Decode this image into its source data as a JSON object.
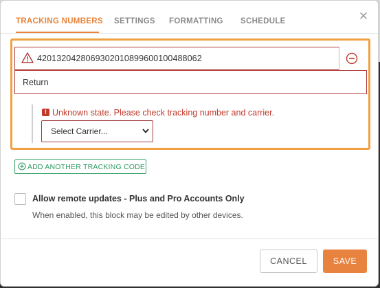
{
  "tabs": [
    {
      "label": "TRACKING NUMBERS",
      "active": true
    },
    {
      "label": "SETTINGS",
      "active": false
    },
    {
      "label": "FORMATTING",
      "active": false
    },
    {
      "label": "SCHEDULE",
      "active": false
    }
  ],
  "close_icon": "close-icon",
  "tracking": {
    "number": "420132042806930201089960010048806 2",
    "number_display": "4201320428069302010899600100488062",
    "description": "Return",
    "error_message": "Unknown state. Please check tracking number and carrier.",
    "carrier_selected": "Select Carrier...",
    "warning_icon": "warning-triangle-icon",
    "remove_icon": "minus-circle-icon"
  },
  "add_tracking_label": "ADD ANOTHER TRACKING CODE",
  "remote_updates": {
    "label": "Allow remote updates - Plus and Pro Accounts Only",
    "help": "When enabled, this block may be edited by other devices.",
    "checked": false
  },
  "footer": {
    "cancel_label": "CANCEL",
    "save_label": "SAVE"
  },
  "colors": {
    "accent": "#e8833a",
    "error": "#c0392b",
    "success": "#2e9a62",
    "highlight": "#f0a040"
  }
}
